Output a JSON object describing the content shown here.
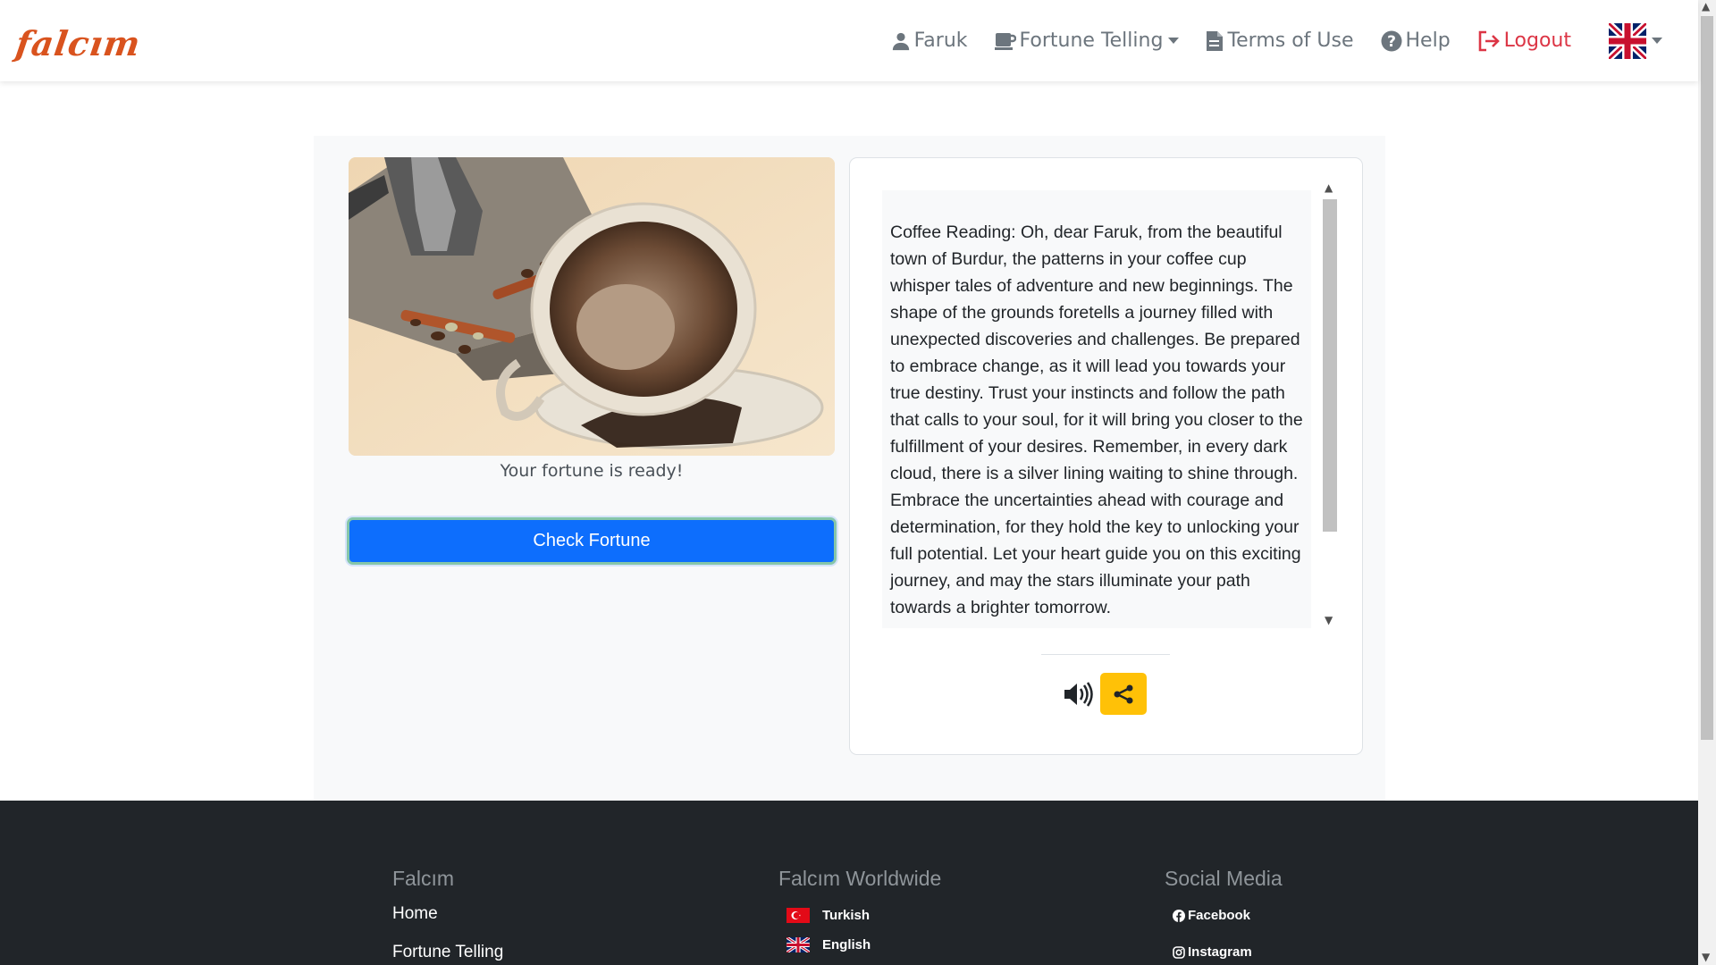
{
  "brand": {
    "logo_text": "falcım"
  },
  "nav": {
    "user_label": "Faruk",
    "fortune_label": "Fortune Telling",
    "terms_label": "Terms of Use",
    "help_label": "Help",
    "logout_label": "Logout",
    "language_flag": "uk-flag-icon"
  },
  "main": {
    "caption": "Your fortune is ready!",
    "check_button": "Check Fortune",
    "reading": "Coffee Reading: Oh, dear Faruk, from the beautiful town of Burdur, the patterns in your coffee cup whisper tales of adventure and new beginnings. The shape of the grounds foretells a journey filled with unexpected discoveries and challenges. Be prepared to embrace change, as it will lead you towards your true destiny. Trust your instincts and follow the path that calls to your soul, for it will bring you closer to the fulfillment of your desires. Remember, in every dark cloud, there is a silver lining waiting to shine through. Embrace the uncertainties ahead with courage and determination, for they hold the key to unlocking your full potential. Let your heart guide you on this exciting journey, and may the stars illuminate your path towards a brighter tomorrow."
  },
  "footer": {
    "col1": {
      "title": "Falcım",
      "links": [
        "Home",
        "Fortune Telling"
      ]
    },
    "col2": {
      "title": "Falcım Worldwide",
      "links": [
        "Turkish",
        "English"
      ]
    },
    "col3": {
      "title": "Social Media",
      "links": [
        "Facebook",
        "Instagram"
      ]
    }
  },
  "colors": {
    "primary": "#0d6efd",
    "warning": "#ffc107",
    "danger": "#dc3545",
    "brand": "#d9531e",
    "footer_bg": "#212529"
  }
}
